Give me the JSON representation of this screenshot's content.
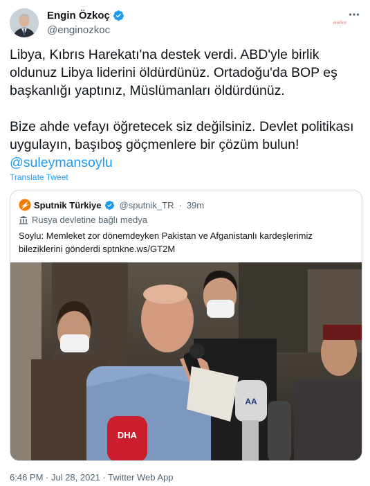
{
  "author": {
    "name": "Engin Özkoç",
    "handle": "@enginozkoc",
    "verified_icon": "verified-badge-icon",
    "more_icon": "more-options-icon"
  },
  "watermark": "ealse",
  "tweet": {
    "paragraph1": "Libya, Kıbrıs Harekatı'na destek verdi. ABD'yle birlik oldunuz Libya liderini öldürdünüz. Ortadoğu'da BOP eş başkanlığı yaptınız, Müslümanları öldürdünüz.",
    "paragraph2": "Bize ahde vefayı öğretecek siz değilsiniz. Devlet politikası uygulayın, başıboş göçmenlere bir çözüm bulun!",
    "mention": "@suleymansoylu",
    "translate_label": "Translate Tweet"
  },
  "quote": {
    "name": "Sputnik Türkiye",
    "handle": "@sputnik_TR",
    "separator": "·",
    "time": "39m",
    "state_label": "Rusya devletine bağlı medya",
    "text": "Soylu: Memleket zor dönemdeyken Pakistan ve Afganistanlı kardeşlerimiz bileziklerini gönderdi sptnkne.ws/GT2M",
    "mic_labels": [
      "DHA",
      "AA"
    ]
  },
  "meta": {
    "timestamp": "6:46 PM · Jul 28, 2021 · Twitter Web App"
  },
  "colors": {
    "link": "#1d9bf0",
    "secondary": "#536471",
    "border": "#cfd9de"
  }
}
